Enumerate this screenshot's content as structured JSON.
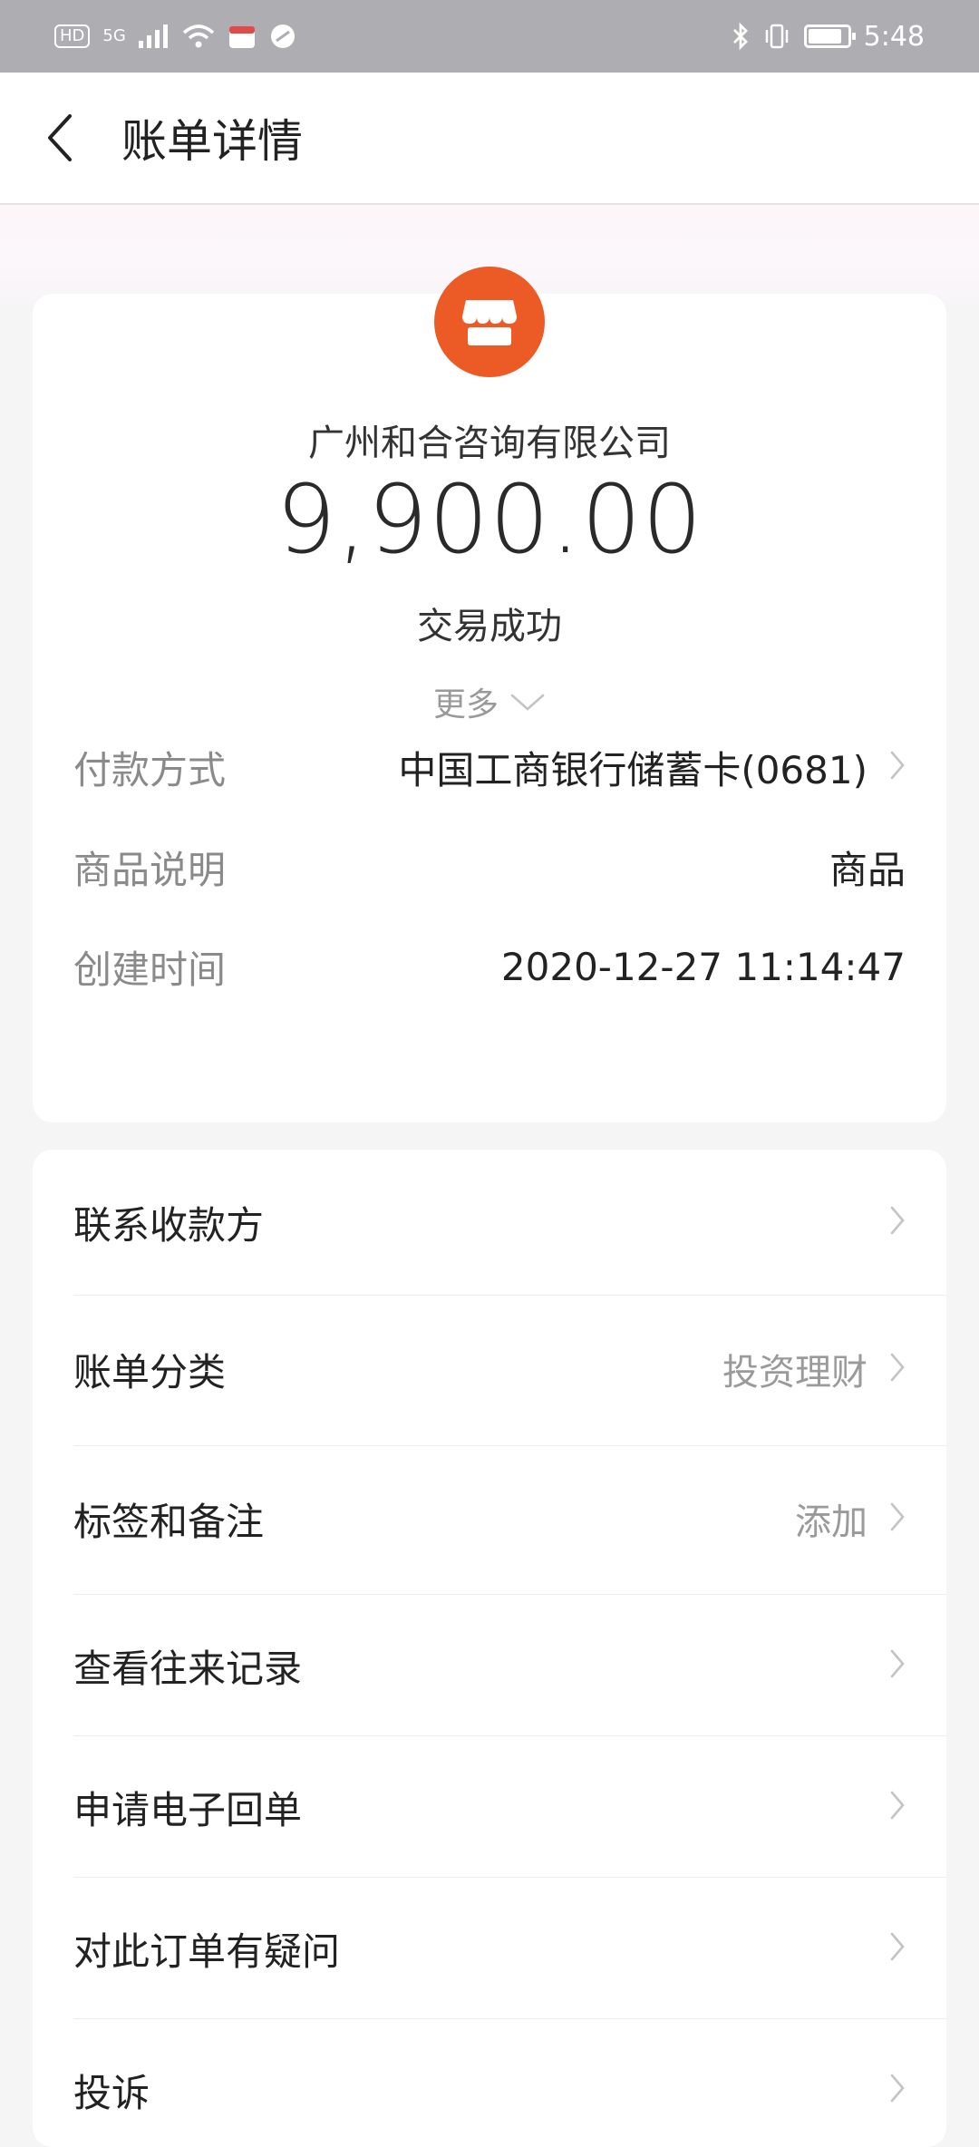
{
  "status_bar": {
    "hd_label": "HD",
    "network_label": "5G",
    "time": "5:48",
    "battery_level": 0.9
  },
  "header": {
    "title": "账单详情"
  },
  "summary": {
    "merchant_name": "广州和合咨询有限公司",
    "amount": "9,900.00",
    "status": "交易成功"
  },
  "details": [
    {
      "label": "付款方式",
      "value": "中国工商银行储蓄卡(0681)"
    },
    {
      "label": "商品说明",
      "value": "商品"
    },
    {
      "label": "创建时间",
      "value": "2020-12-27 11:14:47"
    }
  ],
  "more_label": "更多",
  "actions": [
    {
      "label": "联系收款方",
      "value": ""
    },
    {
      "label": "账单分类",
      "value": "投资理财"
    },
    {
      "label": "标签和备注",
      "value": "添加"
    },
    {
      "label": "查看往来记录",
      "value": ""
    },
    {
      "label": "申请电子回单",
      "value": ""
    },
    {
      "label": "对此订单有疑问",
      "value": ""
    },
    {
      "label": "投诉",
      "value": ""
    }
  ],
  "colors": {
    "status_bar_bg": "#aeadb2",
    "merchant_icon_bg": "#ec5a26",
    "page_bg": "#f5f5f5"
  }
}
